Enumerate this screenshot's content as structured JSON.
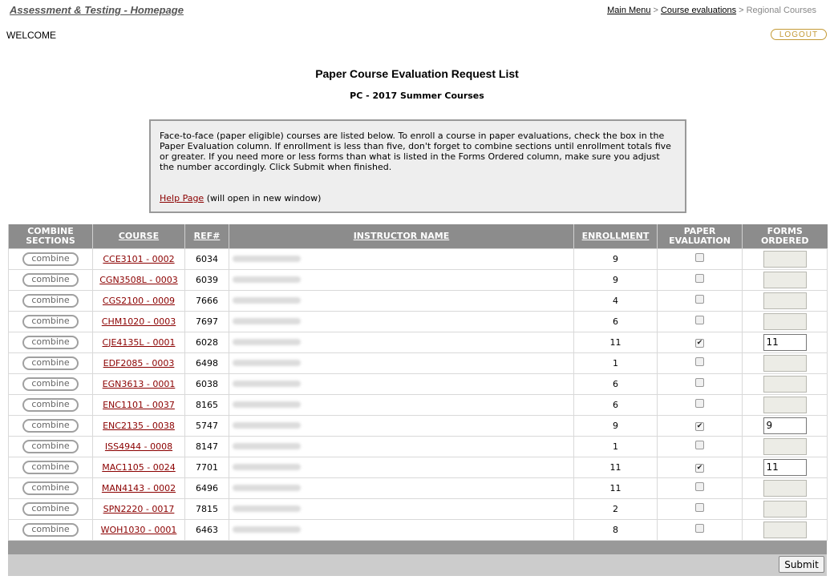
{
  "header": {
    "site_title": "Assessment & Testing - Homepage",
    "breadcrumb": {
      "main_menu": "Main Menu",
      "separator": ">",
      "course_evaluations": "Course evaluations",
      "current": "Regional Courses"
    },
    "welcome": "WELCOME",
    "logout": "LOGOUT"
  },
  "page": {
    "title": "Paper Course Evaluation Request List",
    "subtitle": "PC - 2017 Summer Courses"
  },
  "info": {
    "text": "Face-to-face (paper eligible) courses are listed below. To enroll a course in paper evaluations, check the box in the Paper Evaluation column. If enrollment is less than five, don't forget to combine sections until enrollment totals five or greater. If you need more or less forms than what is listed in the Forms Ordered column, make sure you adjust the number accordingly. Click Submit when finished.",
    "help_link": "Help Page",
    "help_note": " (will open in new window)"
  },
  "table": {
    "headers": {
      "combine": "COMBINE SECTIONS",
      "course": "COURSE",
      "ref": "REF#",
      "instructor": "INSTRUCTOR NAME",
      "enrollment": "ENROLLMENT",
      "paper": "PAPER EVALUATION",
      "forms": "FORMS ORDERED"
    },
    "combine_label": "combine",
    "rows": [
      {
        "course": "CCE3101 - 0002",
        "ref": "6034",
        "enrollment": "9",
        "paper": false,
        "forms": ""
      },
      {
        "course": "CGN3508L - 0003",
        "ref": "6039",
        "enrollment": "9",
        "paper": false,
        "forms": ""
      },
      {
        "course": "CGS2100 - 0009",
        "ref": "7666",
        "enrollment": "4",
        "paper": false,
        "forms": ""
      },
      {
        "course": "CHM1020 - 0003",
        "ref": "7697",
        "enrollment": "6",
        "paper": false,
        "forms": ""
      },
      {
        "course": "CJE4135L - 0001",
        "ref": "6028",
        "enrollment": "11",
        "paper": true,
        "forms": "11"
      },
      {
        "course": "EDF2085 - 0003",
        "ref": "6498",
        "enrollment": "1",
        "paper": false,
        "forms": ""
      },
      {
        "course": "EGN3613 - 0001",
        "ref": "6038",
        "enrollment": "6",
        "paper": false,
        "forms": ""
      },
      {
        "course": "ENC1101 - 0037",
        "ref": "8165",
        "enrollment": "6",
        "paper": false,
        "forms": ""
      },
      {
        "course": "ENC2135 - 0038",
        "ref": "5747",
        "enrollment": "9",
        "paper": true,
        "forms": "9"
      },
      {
        "course": "ISS4944 - 0008",
        "ref": "8147",
        "enrollment": "1",
        "paper": false,
        "forms": ""
      },
      {
        "course": "MAC1105 - 0024",
        "ref": "7701",
        "enrollment": "11",
        "paper": true,
        "forms": "11"
      },
      {
        "course": "MAN4143 - 0002",
        "ref": "6496",
        "enrollment": "11",
        "paper": false,
        "forms": ""
      },
      {
        "course": "SPN2220 - 0017",
        "ref": "7815",
        "enrollment": "2",
        "paper": false,
        "forms": ""
      },
      {
        "course": "WOH1030 - 0001",
        "ref": "6463",
        "enrollment": "8",
        "paper": false,
        "forms": ""
      }
    ]
  },
  "footer": {
    "submit": "Submit"
  }
}
